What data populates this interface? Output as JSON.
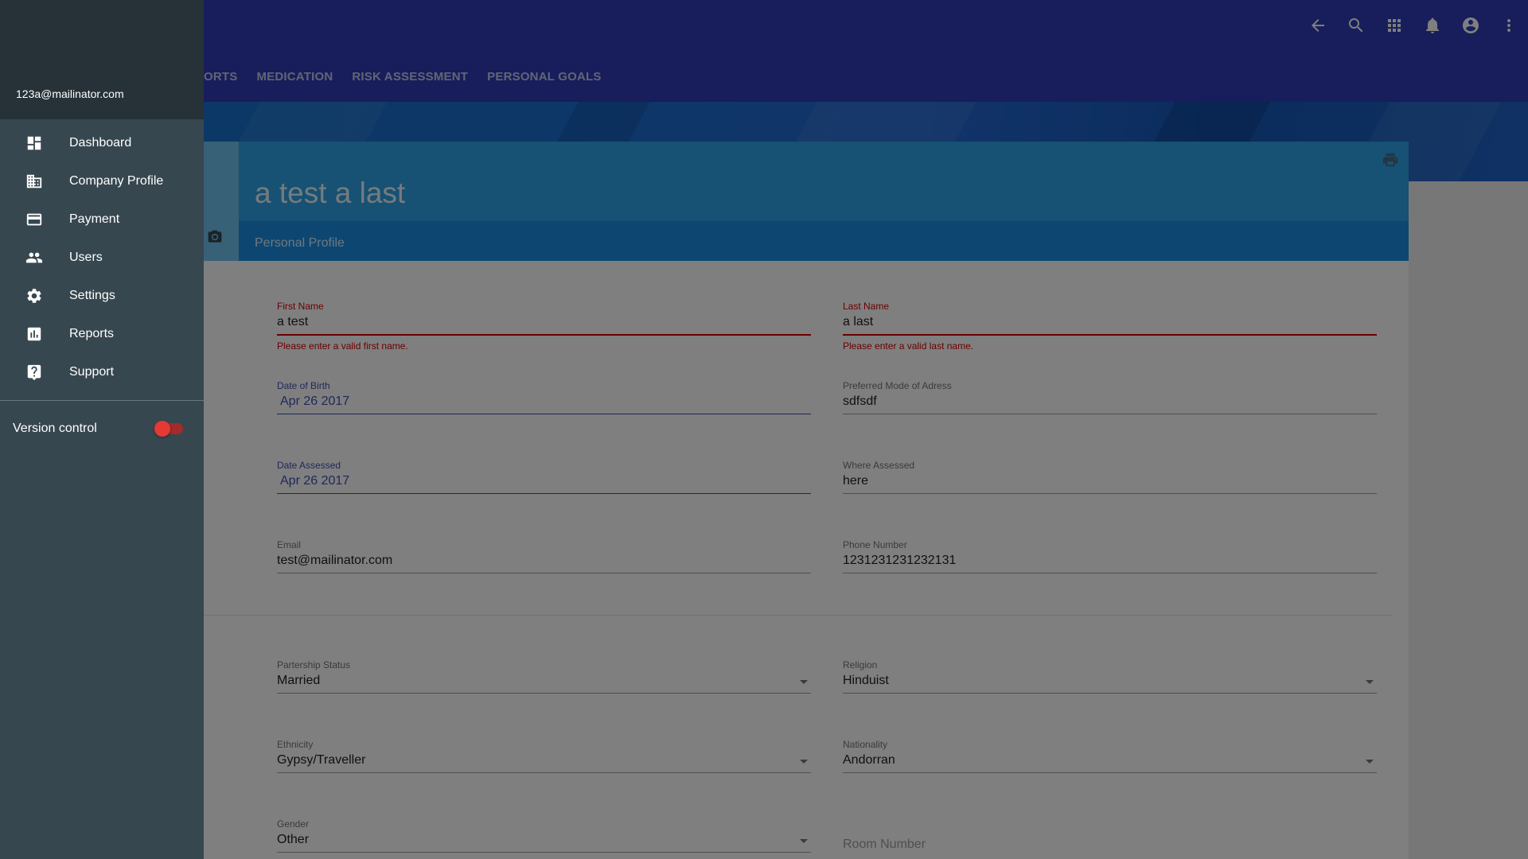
{
  "toolbar": {
    "icons": [
      "arrow-back-icon",
      "search-icon",
      "apps-icon",
      "notifications-icon",
      "account-circle-icon",
      "more-vert-icon"
    ]
  },
  "tabs": [
    {
      "label": "ORTS"
    },
    {
      "label": "MEDICATION"
    },
    {
      "label": "RISK ASSESSMENT"
    },
    {
      "label": "PERSONAL GOALS"
    }
  ],
  "profile": {
    "name": "a test a last",
    "section_label": "Personal Profile"
  },
  "form": {
    "first_name": {
      "label": "First Name",
      "value": "a test",
      "error": "Please enter a valid first name."
    },
    "last_name": {
      "label": "Last Name",
      "value": "a last",
      "error": "Please enter a valid last name."
    },
    "dob": {
      "label": "Date of Birth",
      "value": "Apr 26 2017"
    },
    "preferred_mode": {
      "label": "Preferred Mode of Adress",
      "value": "sdfsdf"
    },
    "date_assessed": {
      "label": "Date Assessed",
      "value": "Apr 26 2017"
    },
    "where_assessed": {
      "label": "Where Assessed",
      "value": "here"
    },
    "email": {
      "label": "Email",
      "value": "test@mailinator.com"
    },
    "phone": {
      "label": "Phone Number",
      "value": "1231231231232131"
    },
    "partnership": {
      "label": "Partership Status",
      "value": "Married"
    },
    "religion": {
      "label": "Religion",
      "value": "Hinduist"
    },
    "ethnicity": {
      "label": "Ethnicity",
      "value": "Gypsy/Traveller"
    },
    "nationality": {
      "label": "Nationality",
      "value": "Andorran"
    },
    "gender": {
      "label": "Gender",
      "value": "Other"
    },
    "room_number": {
      "placeholder": "Room Number"
    }
  },
  "drawer": {
    "user_email": "123a@mailinator.com",
    "items": [
      {
        "label": "Dashboard",
        "icon": "dashboard-icon"
      },
      {
        "label": "Company Profile",
        "icon": "business-icon"
      },
      {
        "label": "Payment",
        "icon": "credit-card-icon"
      },
      {
        "label": "Users",
        "icon": "people-icon"
      },
      {
        "label": "Settings",
        "icon": "settings-icon"
      },
      {
        "label": "Reports",
        "icon": "insert-chart-icon"
      },
      {
        "label": "Support",
        "icon": "help-icon"
      }
    ],
    "version_control": {
      "label": "Version control",
      "enabled": true
    }
  },
  "colors": {
    "appbar": "#2f3db6",
    "drawer": "#37474f",
    "drawer_header": "#263238",
    "card_header": "#2fa3e6",
    "error": "#d50000",
    "toggle": "#e53935"
  }
}
